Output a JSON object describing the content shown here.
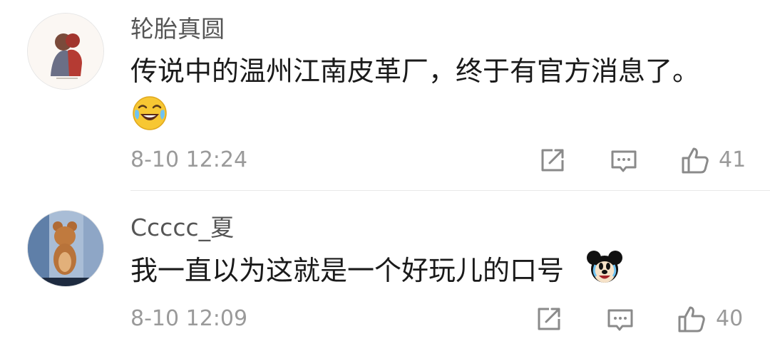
{
  "comments": [
    {
      "username": "轮胎真圆",
      "text": "传说中的温州江南皮革厂，终于有官方消息了。",
      "emoji": "laughing-crying-emoji",
      "timestamp": "8-10 12:24",
      "likes": "41",
      "avatar_caption": "",
      "icons": {
        "share": "share-icon",
        "reply": "comment-icon",
        "like": "thumbs-up-icon"
      }
    },
    {
      "username": "Ccccc_夏",
      "text": "我一直以为这就是一个好玩儿的口号",
      "emoji": "mickey-mouse-emoji",
      "timestamp": "8-10 12:09",
      "likes": "40",
      "avatar_caption": "",
      "icons": {
        "share": "share-icon",
        "reply": "comment-icon",
        "like": "thumbs-up-icon"
      }
    }
  ],
  "colors": {
    "username": "#555555",
    "text": "#1a1a1a",
    "meta": "#9a9a9a",
    "divider": "#e8e8e8",
    "emoji_yellow": "#f7c733"
  }
}
